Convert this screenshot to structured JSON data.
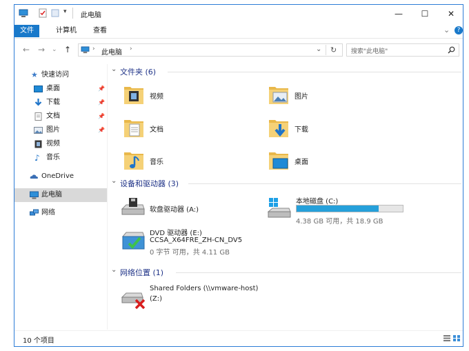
{
  "window": {
    "title": "此电脑",
    "controls": {
      "minimize": "—",
      "maximize": "☐",
      "close": "✕"
    }
  },
  "ribbon": {
    "tabs": [
      "文件",
      "计算机",
      "查看"
    ],
    "help": "?",
    "expand": "⌄"
  },
  "nav": {
    "back": "←",
    "forward": "→",
    "recent": "⌄",
    "up": "↑",
    "address": "此电脑",
    "refresh": "↻",
    "search_placeholder": "搜索\"此电脑\""
  },
  "sidebar": {
    "quick_access": "快速访问",
    "items": [
      "桌面",
      "下载",
      "文档",
      "图片",
      "视频",
      "音乐"
    ],
    "onedrive": "OneDrive",
    "this_pc": "此电脑",
    "network": "网络"
  },
  "groups": {
    "folders": {
      "title": "文件夹 (6)",
      "items": [
        "视频",
        "图片",
        "文档",
        "下载",
        "音乐",
        "桌面"
      ]
    },
    "devices": {
      "title": "设备和驱动器 (3)",
      "floppy": "软盘驱动器 (A:)",
      "local_disk": {
        "name": "本地磁盘 (C:)",
        "info": "4.38 GB 可用，共 18.9 GB",
        "used_fraction": 0.77
      },
      "dvd": {
        "name": "DVD 驱动器 (E:)",
        "label": "CCSA_X64FRE_ZH-CN_DV5",
        "info": "0 字节 可用，共 4.11 GB"
      }
    },
    "network": {
      "title": "网络位置 (1)",
      "share": {
        "name": "Shared Folders (\\\\vmware-host)",
        "drive": "(Z:)"
      }
    }
  },
  "status": {
    "count": "10 个项目"
  },
  "colors": {
    "accent": "#1979ca",
    "header": "#1e3287",
    "drive_fill": "#26a0da",
    "folder": "#f5d177"
  }
}
